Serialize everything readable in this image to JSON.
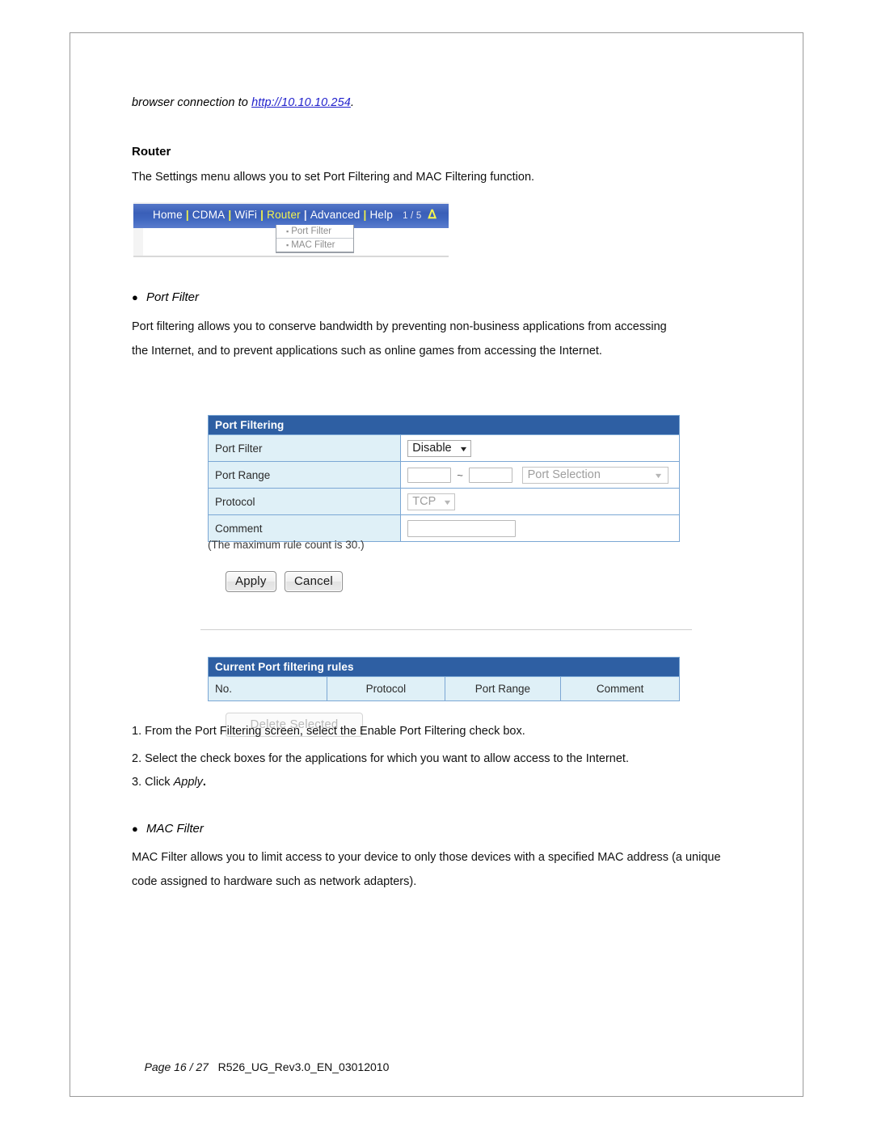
{
  "document": {
    "intro_prefix": "browser connection to ",
    "intro_url": "http://10.10.10.254",
    "intro_suffix": ".",
    "router_heading": "Router",
    "settings_paragraph": "The Settings menu allows you to set Port Filtering and MAC Filtering function.",
    "footer_page": "Page 16 / 27",
    "footer_doc": "R526_UG_Rev3.0_EN_03012010"
  },
  "nav_screenshot": {
    "items": [
      "Home",
      "CDMA",
      "WiFi",
      "Router",
      "Advanced",
      "Help"
    ],
    "active_item": "Router",
    "page_indicator": "1 / 5",
    "signal_icon": "wifi-signal-icon",
    "dropdown": [
      "Port Filter",
      "MAC Filter"
    ]
  },
  "port_filter_section": {
    "bullet": "●",
    "heading": "Port Filter",
    "paragraph_line1": "Port filtering allows you to conserve bandwidth by preventing non-business applications from accessing",
    "paragraph_line2": "the Internet, and to prevent applications such as online games from accessing the Internet."
  },
  "port_filtering_table": {
    "title": "Port Filtering",
    "rows": [
      {
        "label": "Port Filter",
        "control": "select",
        "value": "Disable"
      },
      {
        "label": "Port Range",
        "control": "range",
        "from": "",
        "to": "",
        "separator": "~",
        "selection_placeholder": "Port Selection"
      },
      {
        "label": "Protocol",
        "control": "select-disabled",
        "value": "TCP"
      },
      {
        "label": "Comment",
        "control": "text",
        "value": ""
      }
    ],
    "note": "(The maximum rule count is 30.)",
    "apply_label": "Apply",
    "cancel_label": "Cancel"
  },
  "current_rules_table": {
    "title": "Current Port filtering rules",
    "columns": [
      "No.",
      "Protocol",
      "Port Range",
      "Comment"
    ],
    "rows": [],
    "delete_label": "Delete Selected"
  },
  "steps": {
    "step1": "1. From the Port Filtering screen, select the Enable Port Filtering check box.",
    "step2": "2. Select the check boxes for the applications for which you want to allow access to the Internet.",
    "step3_prefix": "3. Click ",
    "step3_action": "Apply",
    "step3_suffix": "."
  },
  "mac_filter_section": {
    "bullet": "●",
    "heading": "MAC Filter",
    "paragraph_line1": "MAC Filter allows you to limit access to your device to only those devices with a specified MAC address (a unique",
    "paragraph_line2": "code assigned to hardware such as network adapters)."
  },
  "colors": {
    "nav_blue": "#3a5fb8",
    "table_header_blue": "#2e5fa3",
    "label_cell": "#dff0f7",
    "link_blue": "#2222cc",
    "nav_accent_yellow": "#f5f54f"
  }
}
